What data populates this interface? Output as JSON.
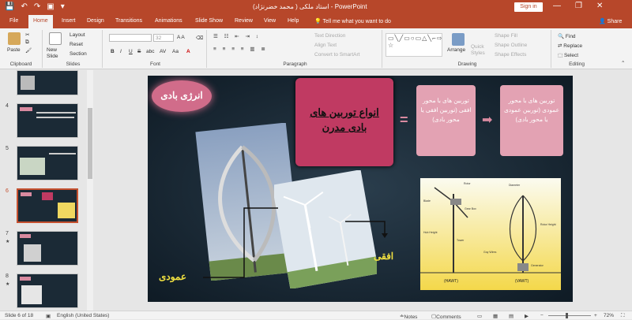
{
  "window": {
    "title": "استاد ملکی ( محمد خضرنژاد) - PowerPoint",
    "sign_in": "Sign in",
    "minimize": "—",
    "restore": "❐",
    "close": "✕"
  },
  "quick_access": {
    "save": "💾",
    "undo": "↶",
    "redo": "↷",
    "present": "▣",
    "customize": "▾"
  },
  "tabs": [
    "File",
    "Home",
    "Insert",
    "Design",
    "Transitions",
    "Animations",
    "Slide Show",
    "Review",
    "View",
    "Help"
  ],
  "active_tab": "Home",
  "tell_me": "Tell me what you want to do",
  "share": "Share",
  "ribbon": {
    "clipboard": {
      "label": "Clipboard",
      "paste": "Paste"
    },
    "slides": {
      "label": "Slides",
      "new_slide": "New Slide",
      "layout": "Layout",
      "reset": "Reset",
      "section": "Section"
    },
    "font": {
      "label": "Font",
      "size": "32",
      "bold": "B",
      "italic": "I",
      "underline": "U",
      "strike": "S",
      "shadow": "abc",
      "spacing": "AV",
      "case": "Aa",
      "color": "A"
    },
    "paragraph": {
      "label": "Paragraph",
      "text_direction": "Text Direction",
      "align_text": "Align Text",
      "smartart": "Convert to SmartArt"
    },
    "drawing": {
      "label": "Drawing",
      "shapes_glyphs": "▭╲╱▭○▭△╲⌐⇨⇧⇩▱⌒⌒╭╮{}☆",
      "arrange": "Arrange",
      "quick_styles": "Quick Styles",
      "shape_fill": "Shape Fill",
      "shape_outline": "Shape Outline",
      "shape_effects": "Shape Effects"
    },
    "editing": {
      "label": "Editing",
      "find": "Find",
      "replace": "Replace",
      "select": "Select"
    }
  },
  "thumbnails": [
    {
      "num": "",
      "star": ""
    },
    {
      "num": "4",
      "star": ""
    },
    {
      "num": "5",
      "star": ""
    },
    {
      "num": "6",
      "star": ""
    },
    {
      "num": "7",
      "star": "★"
    },
    {
      "num": "8",
      "star": "★"
    }
  ],
  "slide": {
    "title_badge": "انرژی بادی",
    "main_box": "انواع توربین های بادی مدرن",
    "equals": "=",
    "box_right": "توربین های با محور افقی (توربین افقی یا محور بادی)",
    "arrow": "➡",
    "box_far": "توربین های با محور عمودی (توربین عمودی یا محور بادی)",
    "label_vertical": "عمودی",
    "label_horizontal": "افقی",
    "diagram_hawt": "(HAWT)",
    "diagram_vawt": "(VAWT)",
    "diagram_labels": [
      "Rotor",
      "Diameter",
      "Blade",
      "Gear Box",
      "Generator",
      "Tower",
      "Guy Wires",
      "Hub Height",
      "Rotor Height"
    ]
  },
  "status": {
    "slide_info": "Slide 6 of 18",
    "language": "English (United States)",
    "notes": "Notes",
    "comments": "Comments",
    "zoom": "72%",
    "minus": "−",
    "plus": "+"
  },
  "colors": {
    "accent": "#b7472a",
    "slide_bg": "#152431",
    "pink_box": "#d98aa0",
    "magenta_box": "#c03a62"
  }
}
